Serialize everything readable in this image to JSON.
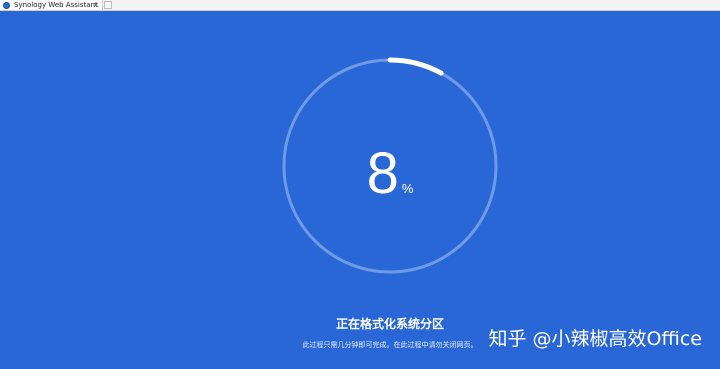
{
  "tab": {
    "title": "Synology Web Assistant",
    "close_glyph": "×",
    "icon": "synology-logo-icon"
  },
  "progress": {
    "value": 8,
    "unit": "%",
    "fraction": 0.08
  },
  "status": {
    "title": "正在格式化系统分区",
    "subtitle": "此过程只需几分钟即可完成。在此过程中请勿关闭网页。"
  },
  "watermark": {
    "text": "知乎 @小辣椒高效Office"
  },
  "colors": {
    "background": "#2a67d6",
    "ring_track": "#6f9be6",
    "ring_progress": "#ffffff",
    "text": "#ffffff"
  }
}
